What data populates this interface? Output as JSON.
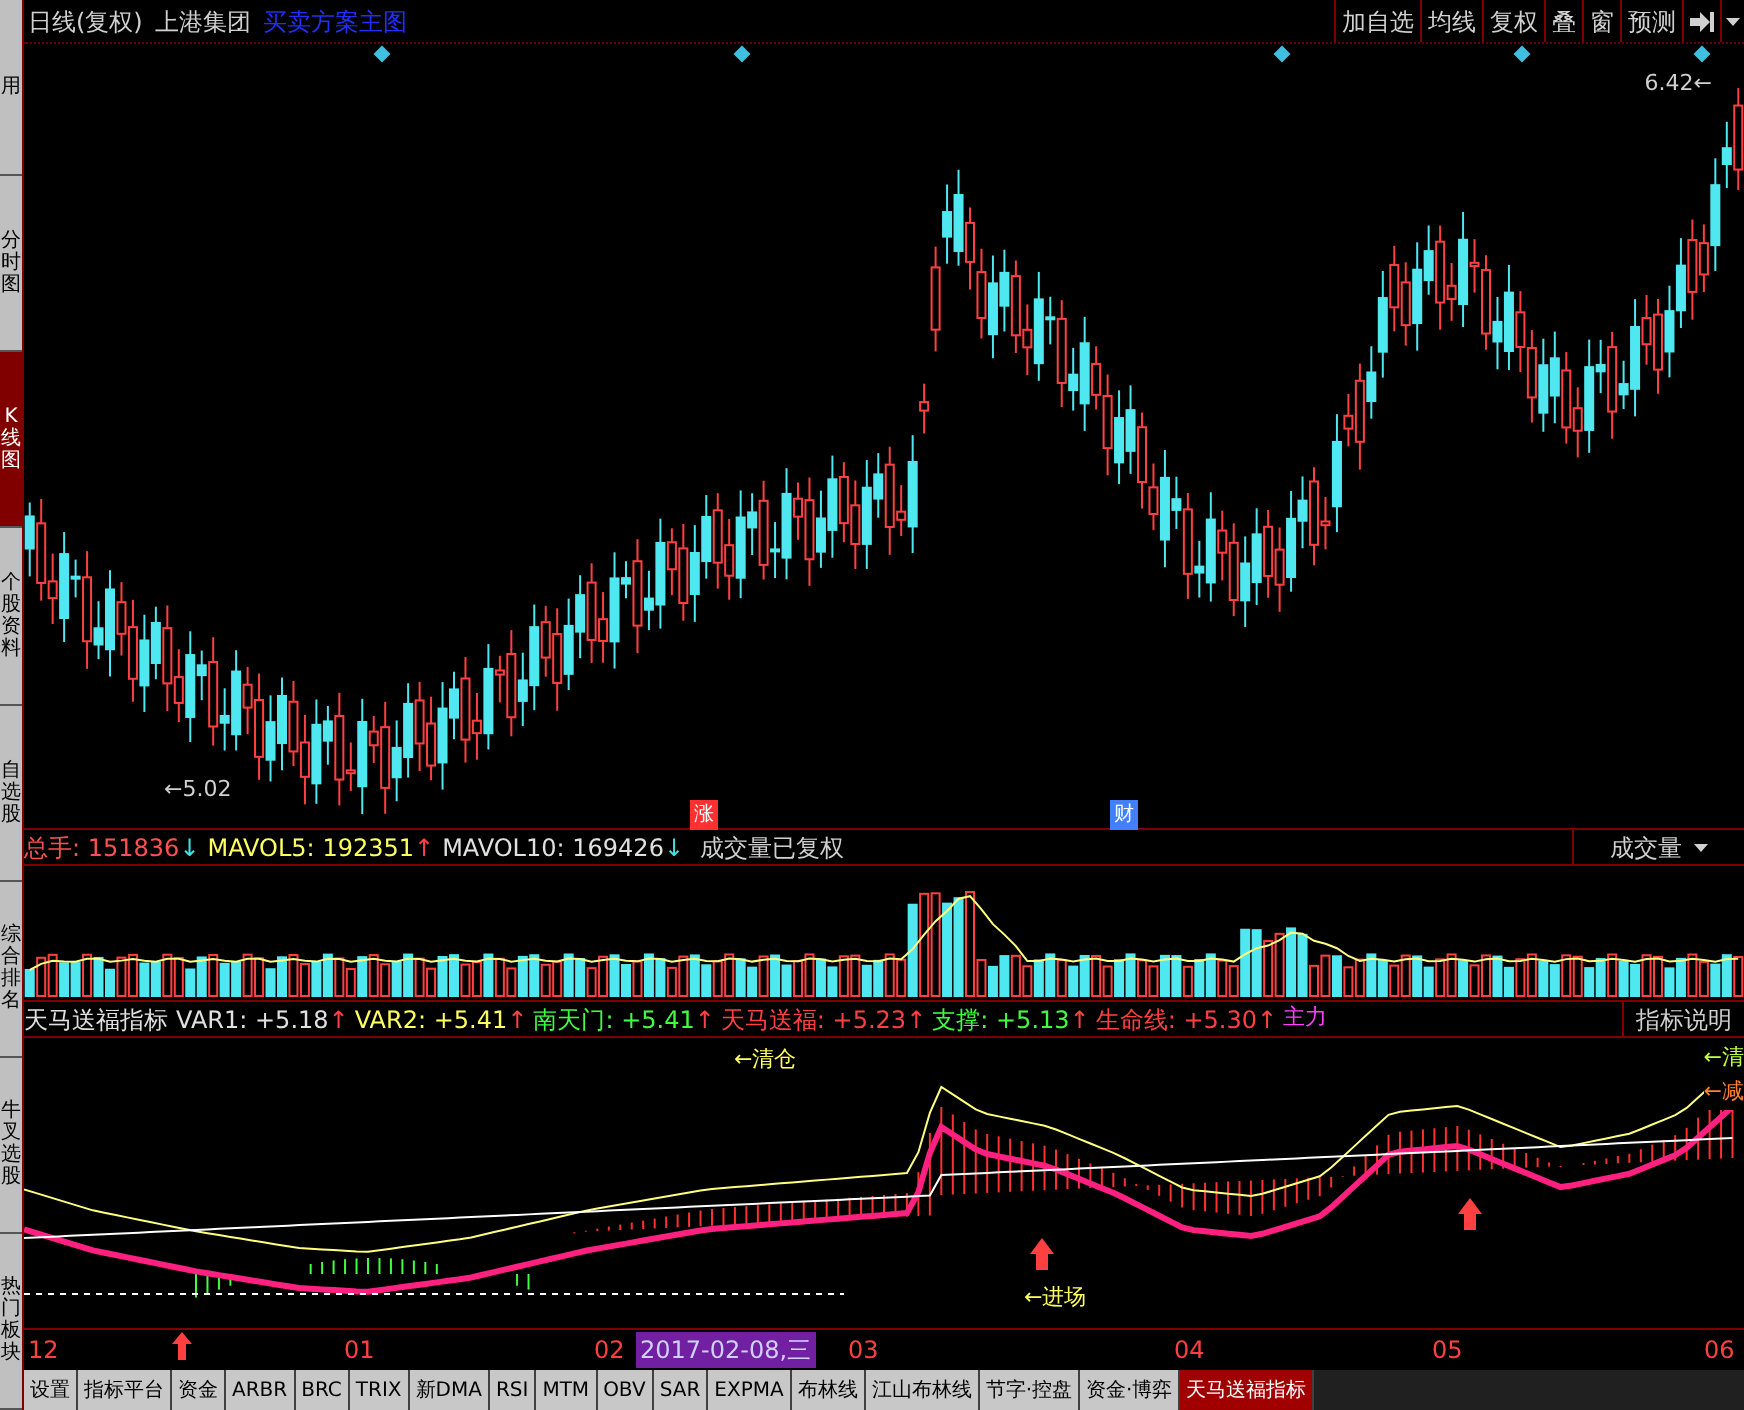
{
  "side_tabs": [
    {
      "label": "用",
      "selected": false
    },
    {
      "label": "分时图",
      "selected": false
    },
    {
      "label": "K线图",
      "selected": true
    },
    {
      "label": "个股资料",
      "selected": false
    },
    {
      "label": "自选股",
      "selected": false
    },
    {
      "label": "综合排名",
      "selected": false
    },
    {
      "label": "牛叉选股",
      "selected": false
    },
    {
      "label": "热门板块",
      "selected": false
    }
  ],
  "header": {
    "period": "日线(复权)",
    "stock": "上港集团",
    "template": "买卖方案主图"
  },
  "toolbar": [
    "加自选",
    "均线",
    "复权",
    "叠",
    "窗",
    "预测"
  ],
  "main_chart": {
    "high_label": "6.42←",
    "low_label": "←5.02",
    "markers": [
      {
        "text": "涨",
        "color": "#ff3030"
      },
      {
        "text": "财",
        "color": "#4080ff"
      }
    ]
  },
  "volume": {
    "items": [
      {
        "label": "总手:",
        "value": "151836",
        "arrow": {
          "text": "↓",
          "color": "#40e0e0"
        },
        "color": "#ff5050"
      },
      {
        "label": "MAVOL5:",
        "value": "192351",
        "arrow": {
          "text": "↑",
          "color": "#ff4040"
        },
        "color": "#ffff60"
      },
      {
        "label": "MAVOL10:",
        "value": "169426",
        "arrow": {
          "text": "↓",
          "color": "#40e0e0"
        },
        "color": "#e0e0e0"
      }
    ],
    "note": "成交量已复权",
    "selector": "成交量"
  },
  "indicator": {
    "name": "天马送福指标",
    "items": [
      {
        "label": "VAR1:",
        "value": "+5.18",
        "arrow": "↑",
        "color": "#e0e0e0"
      },
      {
        "label": "VAR2:",
        "value": "+5.41",
        "arrow": "↑",
        "color": "#ffff60"
      },
      {
        "label": "南天门:",
        "value": "+5.41",
        "arrow": "↑",
        "color": "#40ff40"
      },
      {
        "label": "天马送福:",
        "value": "+5.23",
        "arrow": "↑",
        "color": "#ff4040"
      },
      {
        "label": "支撑:",
        "value": "+5.13",
        "arrow": "↑",
        "color": "#40ff40"
      },
      {
        "label": "生命线:",
        "value": "+5.30",
        "arrow": "↑",
        "color": "#ff4040"
      }
    ],
    "cut_label": "主力",
    "help": "指标说明",
    "signals": [
      "←清仓",
      "←进场",
      "←清",
      "←减"
    ]
  },
  "axis": {
    "labels": [
      "12",
      "01",
      "02",
      "03",
      "04",
      "05",
      "06"
    ],
    "cursor_date": "2017-02-08,三"
  },
  "bottom_tabs": [
    {
      "label": "设置",
      "selected": false
    },
    {
      "label": "指标平台",
      "selected": false
    },
    {
      "label": "资金",
      "selected": false
    },
    {
      "label": "ARBR",
      "selected": false
    },
    {
      "label": "BRC",
      "selected": false
    },
    {
      "label": "TRIX",
      "selected": false
    },
    {
      "label": "新DMA",
      "selected": false
    },
    {
      "label": "RSI",
      "selected": false
    },
    {
      "label": "MTM",
      "selected": false
    },
    {
      "label": "OBV",
      "selected": false
    },
    {
      "label": "SAR",
      "selected": false
    },
    {
      "label": "EXPMA",
      "selected": false
    },
    {
      "label": "布林线",
      "selected": false
    },
    {
      "label": "江山布林线",
      "selected": false
    },
    {
      "label": "节字·控盘",
      "selected": false
    },
    {
      "label": "资金·博弈",
      "selected": false
    },
    {
      "label": "天马送福指标",
      "selected": true
    }
  ]
}
